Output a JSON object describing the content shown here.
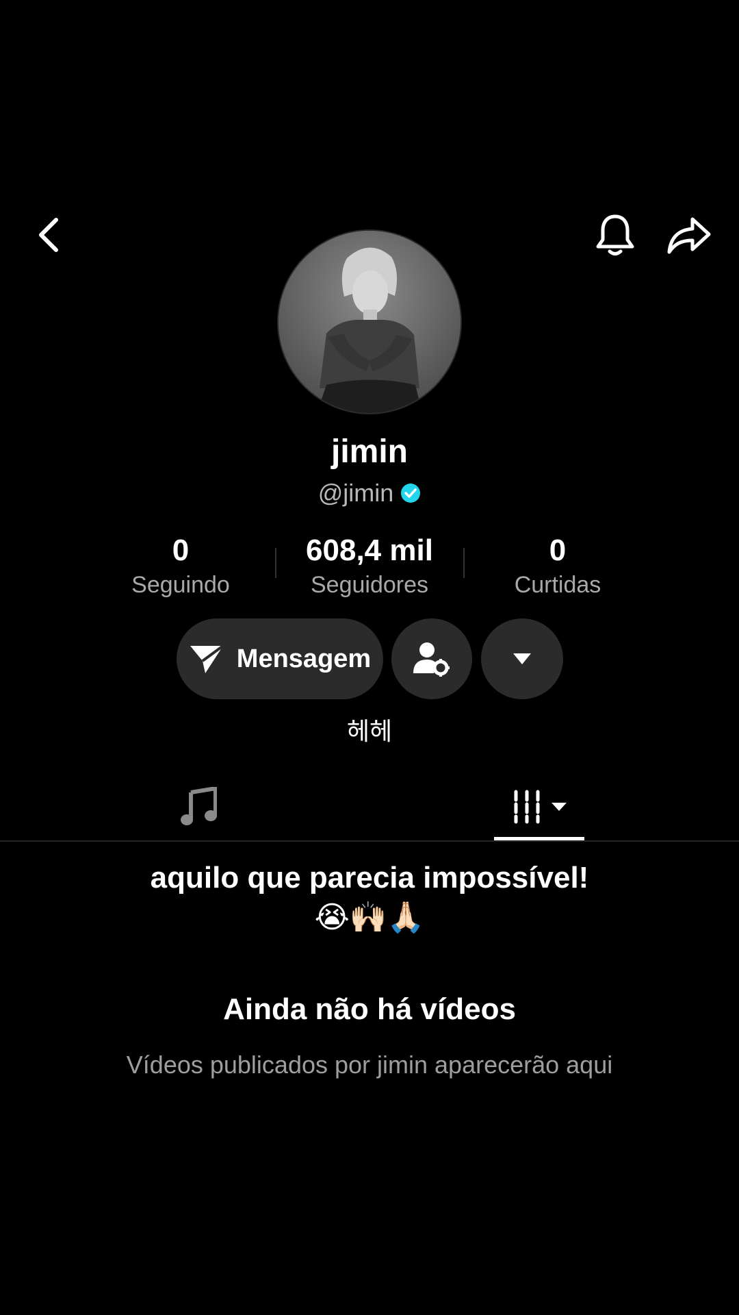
{
  "profile": {
    "display_name": "jimin",
    "handle": "@jimin",
    "verified": true,
    "bio": "헤헤"
  },
  "stats": [
    {
      "value": "0",
      "label": "Seguindo"
    },
    {
      "value": "608,4 mil",
      "label": "Seguidores"
    },
    {
      "value": "0",
      "label": "Curtidas"
    }
  ],
  "actions": {
    "message_label": "Mensagem"
  },
  "tabs": {
    "music_icon": "music-note-icon",
    "videos_icon": "grid-icon",
    "active": "videos"
  },
  "caption": {
    "text": "aquilo que parecia impossível!",
    "emoji": "😭🙌🏻🙏🏻"
  },
  "empty_state": {
    "title": "Ainda não há vídeos",
    "subtitle": "Vídeos publicados por jimin aparecerão aqui"
  },
  "colors": {
    "background": "#000000",
    "button_bg": "#2b2b2b",
    "verified": "#20d5ec",
    "muted_text": "#a9a9a9"
  }
}
